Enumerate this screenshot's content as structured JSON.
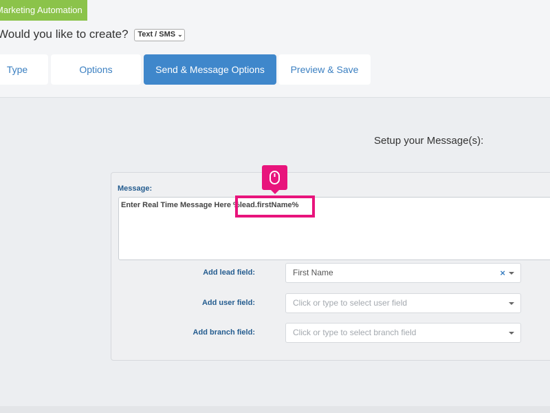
{
  "header": {
    "badge_label": "Marketing Automation",
    "question_text": "Would you like to create?",
    "type_select_value": "Text / SMS"
  },
  "tabs": [
    {
      "label": "Type",
      "active": false
    },
    {
      "label": "Options",
      "active": false
    },
    {
      "label": "Send & Message Options",
      "active": true
    },
    {
      "label": "Preview & Save",
      "active": false
    }
  ],
  "main": {
    "setup_title": "Setup your Message(s):",
    "message_label": "Message:",
    "message_text": "Enter Real Time Message Here %lead.firstName%",
    "lead_field": {
      "label": "Add lead field:",
      "value": "First Name",
      "clear_icon": "×"
    },
    "user_field": {
      "label": "Add user field:",
      "placeholder": "Click or type to select user field"
    },
    "branch_field": {
      "label": "Add branch field:",
      "placeholder": "Click or type to select branch field"
    }
  },
  "colors": {
    "accent": "#3f87cb",
    "badge": "#8bc34a",
    "highlight": "#e8147c"
  },
  "icons": {
    "click_marker": "mouse-icon"
  }
}
